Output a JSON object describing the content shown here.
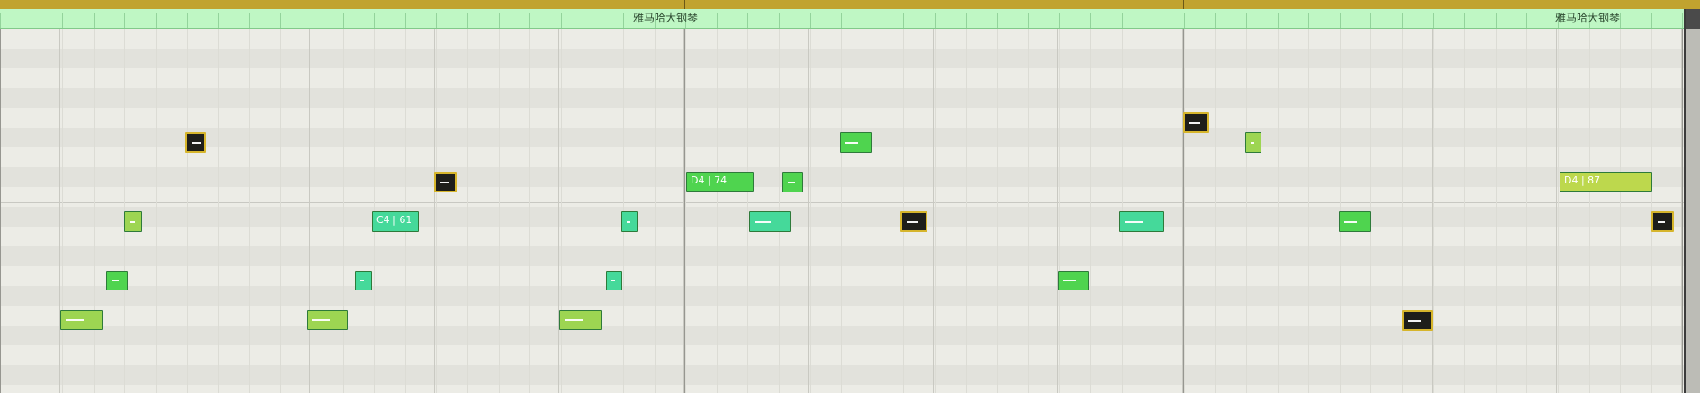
{
  "clip": {
    "name": "雅马哈大钢琴"
  },
  "colors": {
    "green": "#4fd44f",
    "teal": "#45d99a",
    "lime": "#9dd552",
    "yellow_green": "#bdd84d",
    "selected_fill": "#1e1e1a",
    "selected_border": "#d6b52c"
  },
  "notes": [
    {
      "label": "C4 | 61"
    },
    {
      "label": "D4 | 74"
    },
    {
      "label": "D4 | 87"
    }
  ]
}
